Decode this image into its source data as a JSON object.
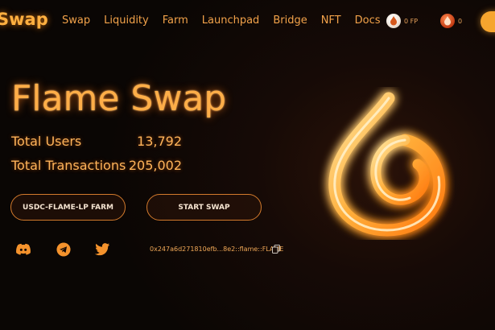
{
  "brand": {
    "name": "Swap"
  },
  "nav": {
    "links": [
      "Swap",
      "Liquidity",
      "Farm",
      "Launchpad",
      "Bridge",
      "NFT",
      "Docs"
    ]
  },
  "wallet": {
    "fp_balance": "0 FP",
    "flame_balance": "0"
  },
  "hero": {
    "title": "Flame Swap",
    "stats": [
      {
        "label": "Total Users",
        "value": "13,792"
      },
      {
        "label": "Total Transactions",
        "value": "205,002"
      }
    ],
    "buttons": {
      "farm": "USDC-FLAME-LP FARM",
      "swap": "START SWAP"
    },
    "social_icons": [
      "discord-icon",
      "telegram-icon",
      "twitter-icon"
    ],
    "contract_address": "0x247a6d271810efb...8e2::flame::FLAME"
  },
  "colors": {
    "accent": "#ffae48",
    "button_border": "#d37a2c",
    "background": "#0a0604"
  }
}
